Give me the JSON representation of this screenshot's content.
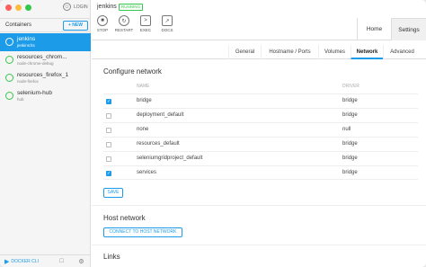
{
  "sidebar": {
    "login_label": "LOGIN",
    "containers_title": "Containers",
    "new_button": "+ NEW",
    "items": [
      {
        "name": "jenkins",
        "image": "jenkins:lts",
        "selected": true
      },
      {
        "name": "resources_chrom...",
        "image": "node-chrome-debug",
        "selected": false
      },
      {
        "name": "resources_firefox_1",
        "image": "node-firefox",
        "selected": false
      },
      {
        "name": "selenium-hub",
        "image": "hub",
        "selected": false
      }
    ],
    "docker_cli_label": "DOCKER CLI"
  },
  "header": {
    "container_name": "jenkins",
    "status": "RUNNING",
    "status_color": "#34c84a",
    "tools": [
      {
        "label": "STOP",
        "icon": "stop-icon"
      },
      {
        "label": "RESTART",
        "icon": "restart-icon"
      },
      {
        "label": "EXEC",
        "icon": "exec-icon"
      },
      {
        "label": "DOCS",
        "icon": "docs-icon"
      }
    ],
    "tabs": {
      "home": "Home",
      "settings": "Settings"
    }
  },
  "subtabs": [
    "General",
    "Hostname / Ports",
    "Volumes",
    "Network",
    "Advanced"
  ],
  "active_subtab": "Network",
  "network": {
    "title": "Configure network",
    "col_name": "NAME",
    "col_driver": "DRIVER",
    "rows": [
      {
        "name": "bridge",
        "driver": "bridge",
        "checked": true
      },
      {
        "name": "deployment_default",
        "driver": "bridge",
        "checked": false
      },
      {
        "name": "none",
        "driver": "null",
        "checked": false
      },
      {
        "name": "resources_default",
        "driver": "bridge",
        "checked": false
      },
      {
        "name": "seleniumgridproject_default",
        "driver": "bridge",
        "checked": false
      },
      {
        "name": "services",
        "driver": "bridge",
        "checked": true
      }
    ],
    "save_button": "SAVE"
  },
  "host_network": {
    "title": "Host network",
    "button": "CONNECT TO HOST NETWORK"
  },
  "links": {
    "title": "Links"
  },
  "accent_color": "#1c9ce8"
}
